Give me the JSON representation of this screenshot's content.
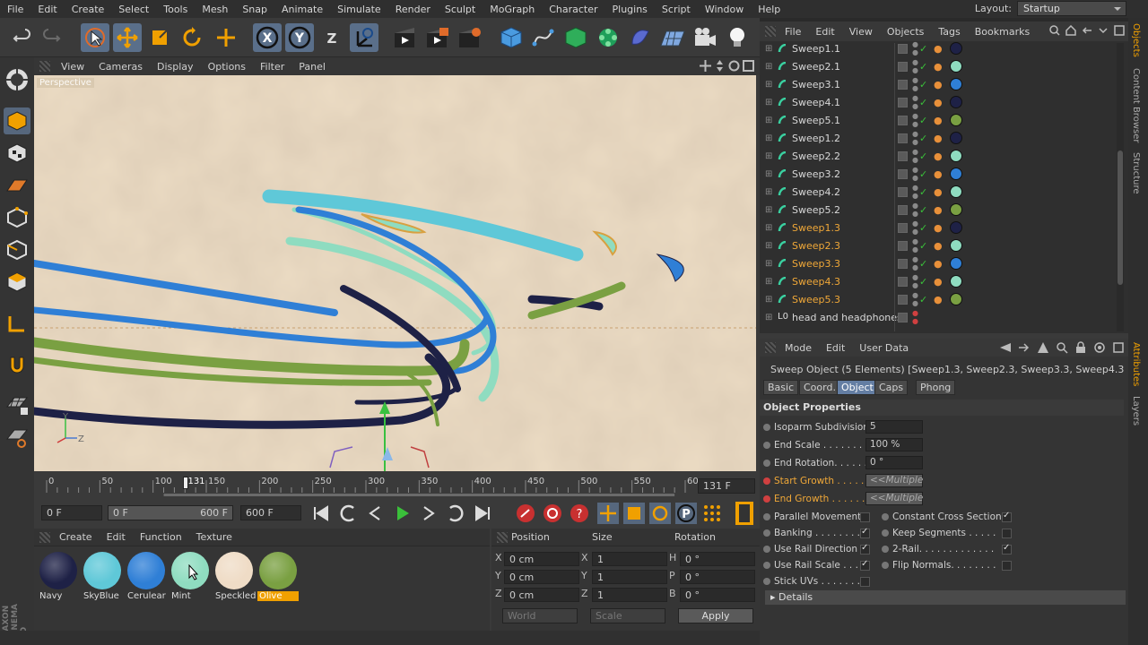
{
  "menubar": {
    "items": [
      "File",
      "Edit",
      "Create",
      "Select",
      "Tools",
      "Mesh",
      "Snap",
      "Animate",
      "Simulate",
      "Render",
      "Sculpt",
      "MoGraph",
      "Character",
      "Plugins",
      "Script",
      "Window",
      "Help"
    ],
    "layout_label": "Layout:",
    "layout_value": "Startup"
  },
  "toolbar": {
    "icons": [
      "undo-icon",
      "redo-icon",
      "live-selection-icon",
      "move-icon",
      "scale-icon",
      "rotate-icon",
      "last-tool-icon",
      "x-axis-icon",
      "y-axis-icon",
      "z-axis-icon",
      "world-coord-icon",
      "render-view-icon",
      "render-picture-viewer-icon",
      "render-settings-icon",
      "cube-icon",
      "pen-spline-icon",
      "subdivision-icon",
      "cloner-icon",
      "deformer-icon",
      "floor-icon",
      "camera-icon",
      "light-icon"
    ],
    "x_label": "X",
    "y_label": "Y",
    "z_label": "Z"
  },
  "viewport": {
    "menu": [
      "View",
      "Cameras",
      "Display",
      "Options",
      "Filter",
      "Panel"
    ],
    "view_label": "Perspective",
    "axis_y": "Y",
    "axis_z": "Z"
  },
  "timeline": {
    "ticks": [
      "0",
      "50",
      "100",
      "131",
      "150",
      "200",
      "250",
      "300",
      "350",
      "400",
      "450",
      "500",
      "550",
      "600"
    ],
    "current_frame": "131 F",
    "current_fraction": 0.2183
  },
  "playback": {
    "start": "0 F",
    "range_start": "0 F",
    "range_end": "600 F",
    "end": "600 F"
  },
  "materials": {
    "menu": [
      "Create",
      "Edit",
      "Function",
      "Texture"
    ],
    "items": [
      {
        "name": "Navy",
        "color": "#1e2146"
      },
      {
        "name": "SkyBlue",
        "color": "#5fc8d8"
      },
      {
        "name": "Cerulear",
        "color": "#2f7fd6"
      },
      {
        "name": "Mint",
        "color": "#8fdcc0"
      },
      {
        "name": "Speckled",
        "color": "#efdcc6"
      },
      {
        "name": "Olive",
        "color": "#7aa042"
      }
    ],
    "selected": "Olive"
  },
  "coords": {
    "headers": [
      "Position",
      "Size",
      "Rotation"
    ],
    "rows": [
      {
        "axis": "X",
        "pos": "0 cm",
        "size_axis": "X",
        "size": "1",
        "rot_axis": "H",
        "rot": "0 °"
      },
      {
        "axis": "Y",
        "pos": "0 cm",
        "size_axis": "Y",
        "size": "1",
        "rot_axis": "P",
        "rot": "0 °"
      },
      {
        "axis": "Z",
        "pos": "0 cm",
        "size_axis": "Z",
        "size": "1",
        "rot_axis": "B",
        "rot": "0 °"
      }
    ],
    "mode_world": "World",
    "mode_scale": "Scale",
    "apply": "Apply"
  },
  "objects": {
    "menu": [
      "File",
      "Edit",
      "View",
      "Objects",
      "Tags",
      "Bookmarks"
    ],
    "rows": [
      {
        "name": "Sweep1.1",
        "color": "#1e2146",
        "hl": false
      },
      {
        "name": "Sweep2.1",
        "color": "#8fdcc0",
        "hl": false
      },
      {
        "name": "Sweep3.1",
        "color": "#2f7fd6",
        "hl": false
      },
      {
        "name": "Sweep4.1",
        "color": "#1e2146",
        "hl": false
      },
      {
        "name": "Sweep5.1",
        "color": "#7aa042",
        "hl": false
      },
      {
        "name": "Sweep1.2",
        "color": "#1e2146",
        "hl": false
      },
      {
        "name": "Sweep2.2",
        "color": "#8fdcc0",
        "hl": false
      },
      {
        "name": "Sweep3.2",
        "color": "#2f7fd6",
        "hl": false
      },
      {
        "name": "Sweep4.2",
        "color": "#8fdcc0",
        "hl": false
      },
      {
        "name": "Sweep5.2",
        "color": "#7aa042",
        "hl": false
      },
      {
        "name": "Sweep1.3",
        "color": "#1e2146",
        "hl": true
      },
      {
        "name": "Sweep2.3",
        "color": "#8fdcc0",
        "hl": true
      },
      {
        "name": "Sweep3.3",
        "color": "#2f7fd6",
        "hl": true
      },
      {
        "name": "Sweep4.3",
        "color": "#8fdcc0",
        "hl": true
      },
      {
        "name": "Sweep5.3",
        "color": "#7aa042",
        "hl": true
      },
      {
        "name": "head and headphones",
        "color": "",
        "hl": false
      }
    ]
  },
  "attributes": {
    "menu": [
      "Mode",
      "Edit",
      "User Data"
    ],
    "title": "Sweep Object (5 Elements) [Sweep1.3, Sweep2.3, Sweep3.3, Sweep4.3, Sweep5.3]",
    "tabs": [
      "Basic",
      "Coord.",
      "Object",
      "Caps",
      "Phong"
    ],
    "active_tab": "Object",
    "section": "Object Properties",
    "props": [
      {
        "label": "Isoparm Subdivision",
        "value": "5"
      },
      {
        "label": "End Scale . . . . . . . . .",
        "value": "100 %"
      },
      {
        "label": "End Rotation. . . . . . .",
        "value": "0 °"
      },
      {
        "label": "Start Growth . . . . . .",
        "value": "<<Multiple"
      },
      {
        "label": "End Growth . . . . . . .",
        "value": "<<Multiple"
      }
    ],
    "checks_left": [
      {
        "label": "Parallel Movement",
        "on": false
      },
      {
        "label": "Banking . . . . . . . . . .",
        "on": true
      },
      {
        "label": "Use Rail Direction",
        "on": true
      },
      {
        "label": "Use Rail Scale . . . .",
        "on": true
      },
      {
        "label": "Stick UVs . . . . . . . .",
        "on": false
      }
    ],
    "checks_right": [
      {
        "label": "Constant Cross Section",
        "on": true
      },
      {
        "label": "Keep Segments . . . . .",
        "on": false
      },
      {
        "label": "2-Rail. . . . . . . . . . . . .",
        "on": true
      },
      {
        "label": "Flip Normals. . . . . . . .",
        "on": false
      }
    ],
    "details": "Details"
  },
  "dock": {
    "tabs_top": [
      "Objects",
      "Content Browser",
      "Structure"
    ],
    "tabs_bottom": [
      "Attributes",
      "Layers"
    ]
  },
  "brand": {
    "line1": "MAXON",
    "line2": "CINEMA 4D"
  }
}
